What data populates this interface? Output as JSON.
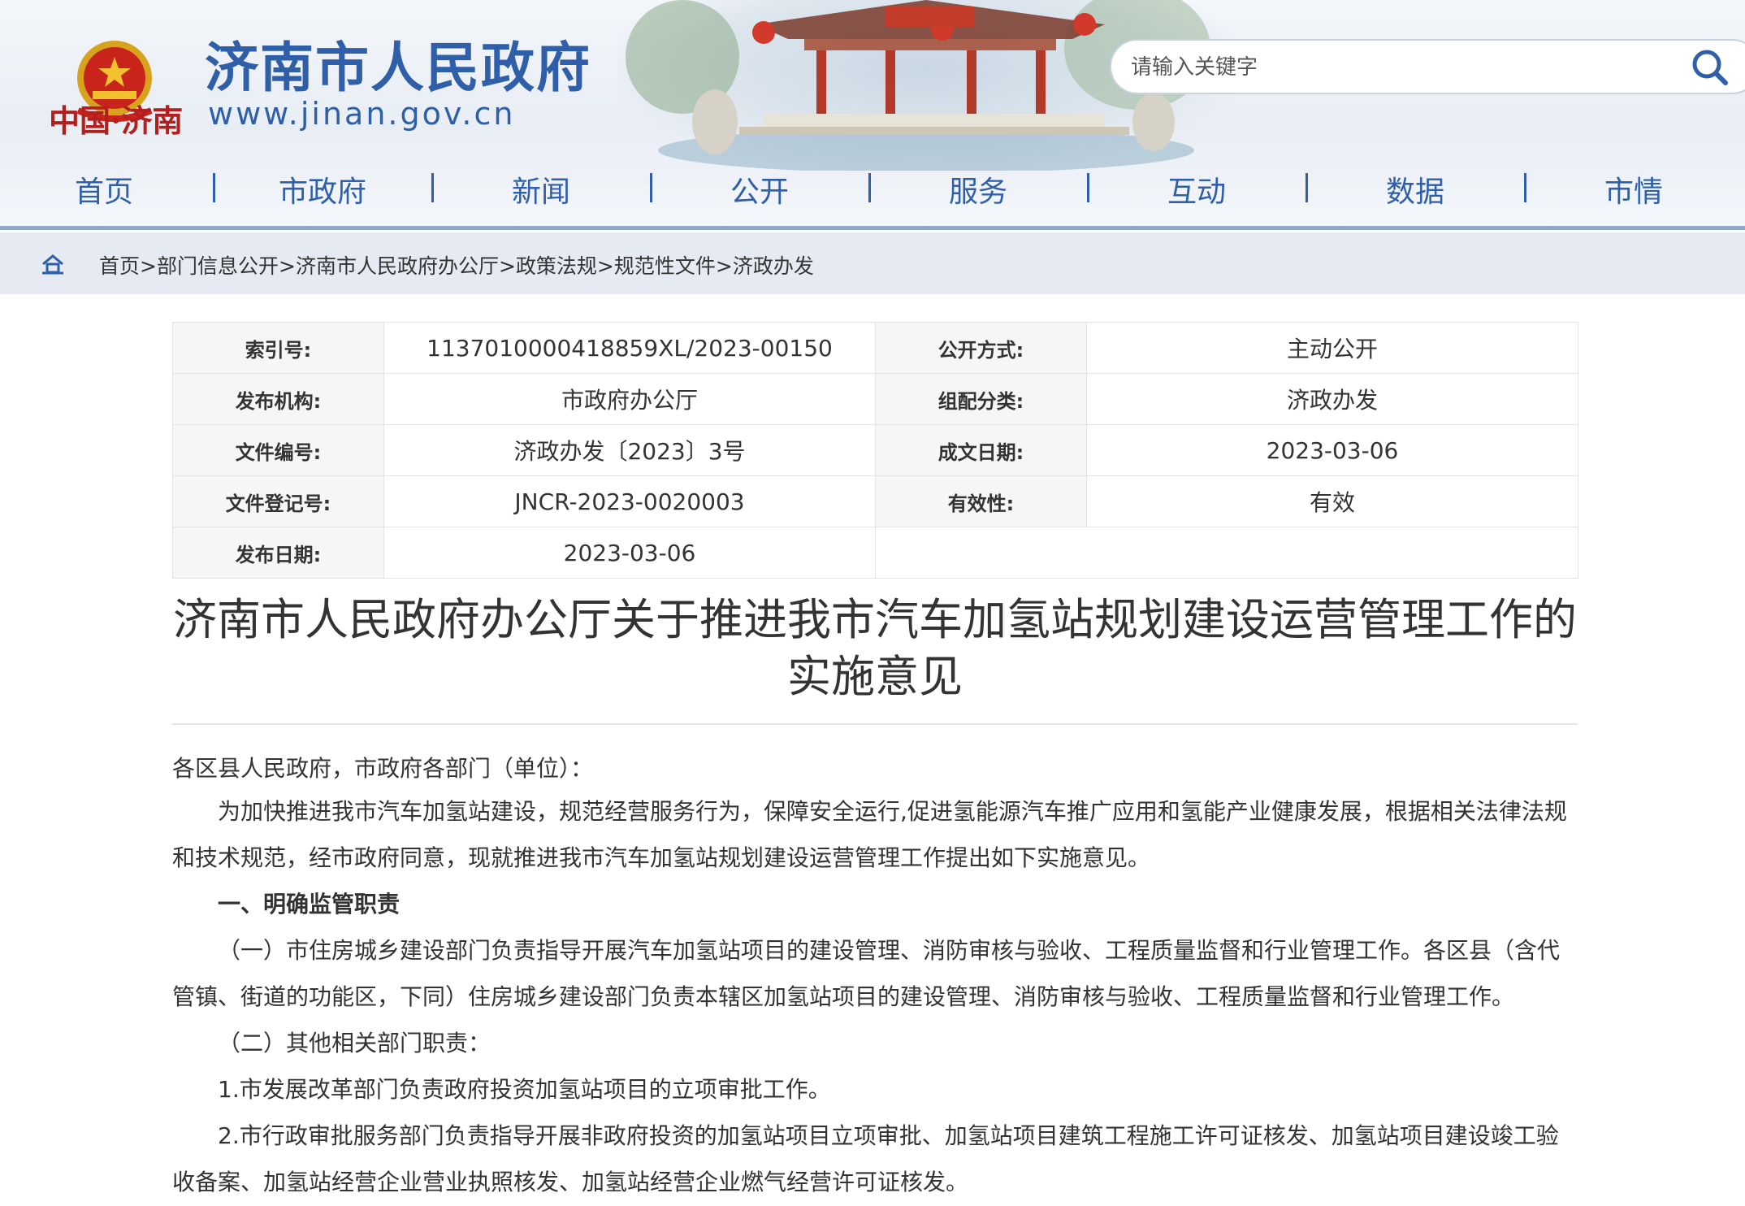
{
  "header": {
    "site_name": "济南市人民政府",
    "site_url": "www.jinan.gov.cn",
    "slogan": "中国·济南",
    "search_placeholder": "请输入关键字",
    "brand_color": "#2e5fa8",
    "icons": {
      "emblem": "national-emblem-icon",
      "search": "search-icon",
      "home": "home-icon"
    }
  },
  "nav": {
    "items": [
      "首页",
      "市政府",
      "新闻",
      "公开",
      "服务",
      "互动",
      "数据",
      "市情"
    ],
    "separator": "|"
  },
  "breadcrumb": {
    "items": [
      "首页",
      "部门信息公开",
      "济南市人民政府办公厅",
      "政策法规",
      "规范性文件",
      "济政办发"
    ],
    "separator": ">"
  },
  "info": {
    "index_label": "索引号:",
    "index_value": "1137010000418859XL/2023-00150",
    "open_label": "公开方式:",
    "open_value": "主动公开",
    "org_label": "发布机构:",
    "org_value": "市政府办公厅",
    "category_label": "组配分类:",
    "category_value": "济政办发",
    "docno_label": "文件编号:",
    "docno_value": "济政办发〔2023〕3号",
    "written_label": "成文日期:",
    "written_value": "2023-03-06",
    "reg_label": "文件登记号:",
    "reg_value": "JNCR-2023-0020003",
    "valid_label": "有效性:",
    "valid_value": "有效",
    "pub_label": "发布日期:",
    "pub_value": "2023-03-06"
  },
  "article": {
    "title_line1": "济南市人民政府办公厅关于推进我市汽车加氢站规划建设运营管理工作的",
    "title_line2": "实施意见",
    "salutation": "各区县人民政府，市政府各部门（单位）：",
    "p1": "为加快推进我市汽车加氢站建设，规范经营服务行为，保障安全运行,促进氢能源汽车推广应用和氢能产业健康发展，根据相关法律法规和技术规范，经市政府同意，现就推进我市汽车加氢站规划建设运营管理工作提出如下实施意见。",
    "h1": "一、明确监管职责",
    "p2": "（一）市住房城乡建设部门负责指导开展汽车加氢站项目的建设管理、消防审核与验收、工程质量监督和行业管理工作。各区县（含代管镇、街道的功能区，下同）住房城乡建设部门负责本辖区加氢站项目的建设管理、消防审核与验收、工程质量监督和行业管理工作。",
    "p3": "（二）其他相关部门职责：",
    "p4": "1.市发展改革部门负责政府投资加氢站项目的立项审批工作。",
    "p5": "2.市行政审批服务部门负责指导开展非政府投资的加氢站项目立项审批、加氢站项目建筑工程施工许可证核发、加氢站项目建设竣工验收备案、加氢站经营企业营业执照核发、加氢站经营企业燃气经营许可证核发。"
  }
}
